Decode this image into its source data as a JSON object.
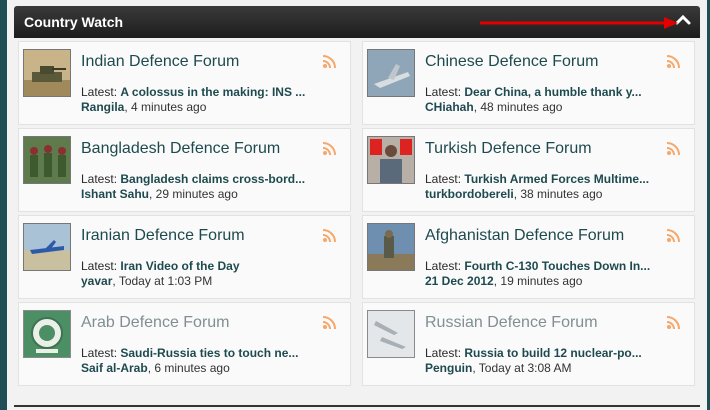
{
  "header": {
    "title": "Country Watch"
  },
  "forums": [
    {
      "name": "Indian Defence Forum",
      "latest_label": "Latest:",
      "post": "A colossus in the making: INS ...",
      "user": "Rangila",
      "time": ", 4 minutes ago",
      "thumb": "tank",
      "faded": false
    },
    {
      "name": "Chinese Defence Forum",
      "latest_label": "Latest:",
      "post": "Dear China, a humble thank y...",
      "user": "CHiahah",
      "time": ", 48 minutes ago",
      "thumb": "jet",
      "faded": false
    },
    {
      "name": "Bangladesh Defence Forum",
      "latest_label": "Latest:",
      "post": "Bangladesh claims cross-bord...",
      "user": "Ishant Sahu",
      "time": ", 29 minutes ago",
      "thumb": "soldiers",
      "faded": false
    },
    {
      "name": "Turkish Defence Forum",
      "latest_label": "Latest:",
      "post": "Turkish Armed Forces Multime...",
      "user": "turkbordobereli",
      "time": ", 38 minutes ago",
      "thumb": "flags",
      "faded": false
    },
    {
      "name": "Iranian Defence Forum",
      "latest_label": "Latest:",
      "post": "Iran Video of the Day",
      "user": "yavar",
      "time": ", Today at 1:03 PM",
      "thumb": "aircraft",
      "faded": false
    },
    {
      "name": "Afghanistan Defence Forum",
      "latest_label": "Latest:",
      "post": "Fourth C-130 Touches Down In...",
      "user": "21 Dec 2012",
      "time": ", 19 minutes ago",
      "thumb": "afghan",
      "faded": false
    },
    {
      "name": "Arab Defence Forum",
      "latest_label": "Latest:",
      "post": "Saudi-Russia ties to touch ne...",
      "user": "Saif al-Arab",
      "time": ", 6 minutes ago",
      "thumb": "emblem",
      "faded": true
    },
    {
      "name": "Russian Defence Forum",
      "latest_label": "Latest:",
      "post": "Russia to build 12 nuclear-po...",
      "user": "Penguin",
      "time": ", Today at 3:08 AM",
      "thumb": "jets",
      "faded": true
    }
  ],
  "colors": {
    "accent": "#1e4a4f",
    "rss": "#f6a76a",
    "header": "#2a2a2a",
    "annotation": "#e00000"
  },
  "icons": {
    "collapse": "chevron-up-icon",
    "feed": "rss-icon"
  }
}
